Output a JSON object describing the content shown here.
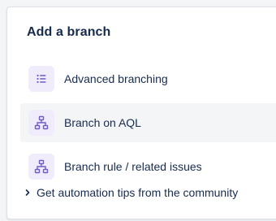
{
  "panel": {
    "title": "Add a branch",
    "items": [
      {
        "label": "Advanced branching",
        "icon": "list-icon"
      },
      {
        "label": "Branch on AQL",
        "icon": "hierarchy-icon"
      },
      {
        "label": "Branch rule / related issues",
        "icon": "hierarchy-icon"
      }
    ],
    "tips_link": "Get automation tips from the community"
  },
  "colors": {
    "icon_bg": "#f0ecfb",
    "icon_fg": "#6e5dc6",
    "text": "#172b4d",
    "hover_bg": "#f4f5f7"
  }
}
